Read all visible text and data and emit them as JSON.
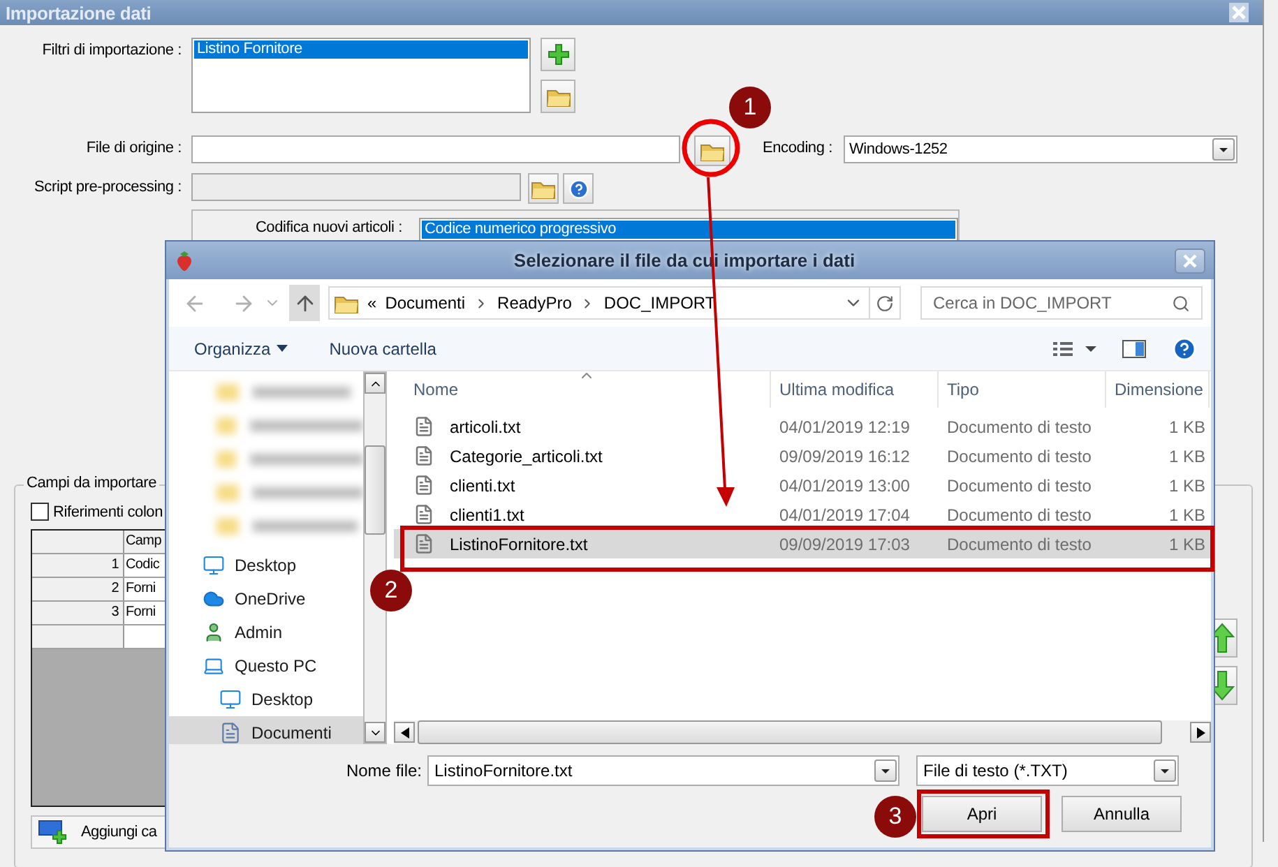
{
  "window": {
    "title": "Importazione dati"
  },
  "filters": {
    "label": "Filtri di importazione :",
    "items": [
      {
        "text": "Listino Fornitore",
        "selected": true
      }
    ]
  },
  "source_file": {
    "label": "File di origine :"
  },
  "encoding": {
    "label": "Encoding :",
    "value": "Windows-1252"
  },
  "script": {
    "label": "Script pre-processing :",
    "disabled": true
  },
  "article_coding": {
    "label": "Codifica nuovi articoli :",
    "options": [
      {
        "text": "Codice numerico progressivo",
        "selected": true
      }
    ]
  },
  "fields_group": {
    "title": "Campi da importare",
    "column_refs": {
      "label": "Riferimenti colon",
      "checked": false
    },
    "table": {
      "column_2": "Camp",
      "rows": [
        {
          "number": "1",
          "field": "Codic"
        },
        {
          "number": "2",
          "field": "Forni"
        },
        {
          "number": "3",
          "field": "Forni"
        }
      ]
    },
    "add_button": "Aggiungi ca"
  },
  "file_dialog": {
    "title": "Selezionare il file da cui importare i dati",
    "path_prefix": "«",
    "path": [
      "Documenti",
      "ReadyPro",
      "DOC_IMPORT"
    ],
    "search": {
      "placeholder": "Cerca in DOC_IMPORT"
    },
    "toolbar": {
      "organize": "Organizza",
      "new_folder": "Nuova cartella"
    },
    "nav_items": [
      {
        "kind": "desktop",
        "label": "Desktop",
        "selected": false
      },
      {
        "kind": "cloud",
        "label": "OneDrive",
        "selected": false
      },
      {
        "kind": "user",
        "label": "Admin",
        "selected": false
      },
      {
        "kind": "pc",
        "label": "Questo PC",
        "selected": false,
        "children": [
          {
            "kind": "desktop",
            "label": "Desktop",
            "selected": false
          },
          {
            "kind": "document",
            "label": "Documenti",
            "selected": true
          }
        ]
      }
    ],
    "columns": [
      "Nome",
      "Ultima modifica",
      "Tipo",
      "Dimensione"
    ],
    "files": [
      {
        "name": "articoli.txt",
        "modified": "04/01/2019 12:19",
        "type": "Documento di testo",
        "size": "1 KB",
        "selected": false
      },
      {
        "name": "Categorie_articoli.txt",
        "modified": "09/09/2019 16:12",
        "type": "Documento di testo",
        "size": "1 KB",
        "selected": false
      },
      {
        "name": "clienti.txt",
        "modified": "04/01/2019 13:00",
        "type": "Documento di testo",
        "size": "1 KB",
        "selected": false
      },
      {
        "name": "clienti1.txt",
        "modified": "04/01/2019 17:04",
        "type": "Documento di testo",
        "size": "1 KB",
        "selected": false
      },
      {
        "name": "ListinoFornitore.txt",
        "modified": "09/09/2019 17:03",
        "type": "Documento di testo",
        "size": "1 KB",
        "selected": true
      }
    ],
    "file_name": {
      "label": "Nome file:",
      "value": "ListinoFornitore.txt"
    },
    "file_type": {
      "value": "File di testo (*.TXT)"
    },
    "buttons": [
      {
        "label": "Apri"
      },
      {
        "label": "Annulla"
      }
    ]
  },
  "annotations": [
    {
      "number": "1"
    },
    {
      "number": "2"
    },
    {
      "number": "3"
    }
  ]
}
